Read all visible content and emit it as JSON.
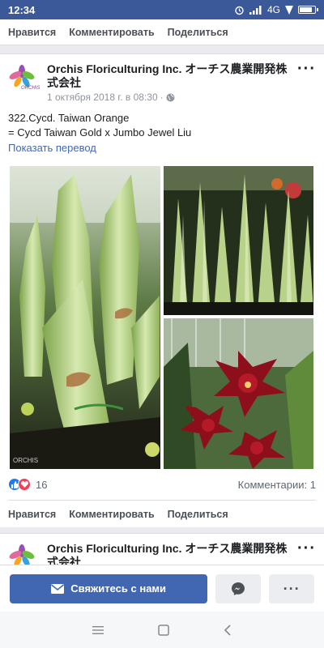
{
  "status_bar": {
    "time": "12:34",
    "network": "4G"
  },
  "top_actions": {
    "like": "Нравится",
    "comment": "Комментировать",
    "share": "Поделиться"
  },
  "post": {
    "page_name": "Orchis Floriculturing Inc. オーチス農業開発株式会社",
    "logo_text": "ORCHIS",
    "date": "1 октября 2018 г. в 08:30",
    "text_line1": "322.Cycd. Taiwan Orange",
    "text_line2": "= Cycd Taiwan Gold x Jumbo Jewel Liu",
    "translate": "Показать перевод",
    "watermark": "ORCHIS",
    "reactions_count": "16",
    "comments": "Комментарии: 1",
    "actions": {
      "like": "Нравится",
      "comment": "Комментировать",
      "share": "Поделиться"
    }
  },
  "post2": {
    "page_name": "Orchis Floriculturing Inc. オーチス農業開発株式会社"
  },
  "cta": {
    "contact": "Свяжитесь с нами"
  },
  "colors": {
    "brand": "#3b5998",
    "button": "#4267b2",
    "like": "#2078f4",
    "love": "#f33e58"
  },
  "battery_level": 0.9
}
